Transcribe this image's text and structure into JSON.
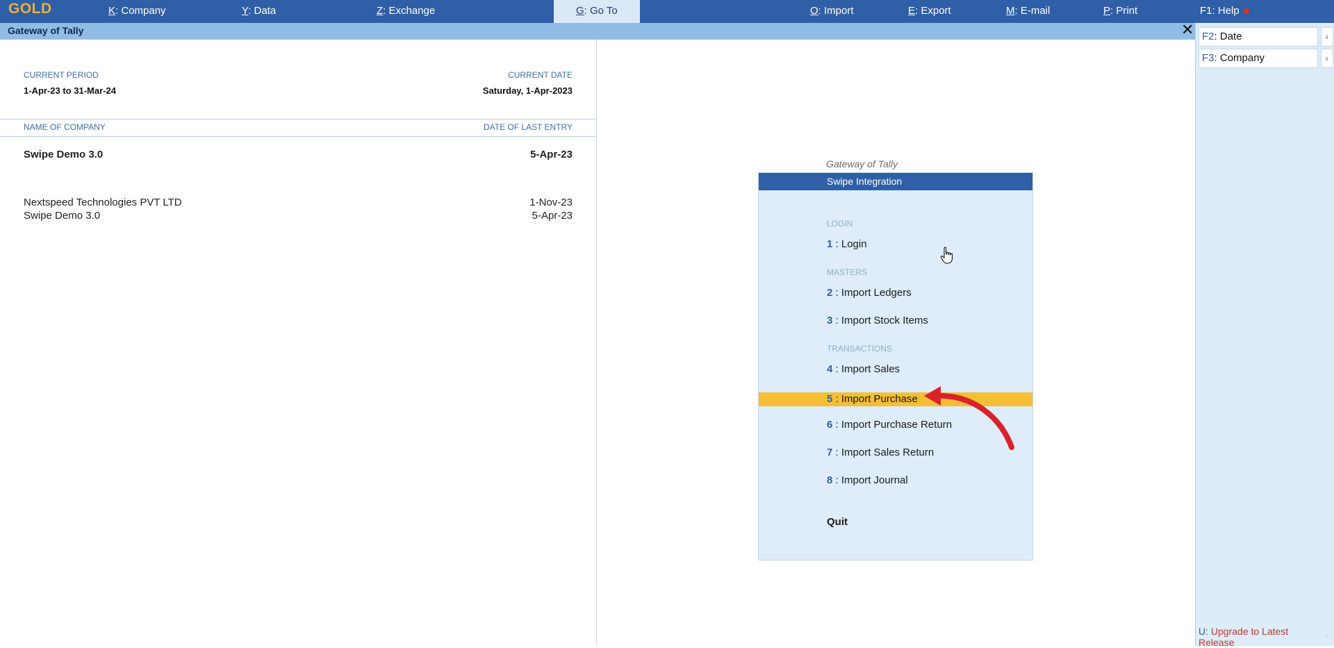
{
  "topbar": {
    "logo": "GOLD",
    "items": [
      {
        "key": "K",
        "label": "Company"
      },
      {
        "key": "Y",
        "label": "Data"
      },
      {
        "key": "Z",
        "label": "Exchange"
      },
      {
        "key": "G",
        "label": "Go To"
      },
      {
        "key": "O",
        "label": "Import"
      },
      {
        "key": "E",
        "label": "Export"
      },
      {
        "key": "M",
        "label": "E-mail"
      },
      {
        "key": "P",
        "label": "Print"
      },
      {
        "key": "F1",
        "label": "Help"
      }
    ]
  },
  "titlebar": {
    "title": "Gateway of Tally",
    "close": "✕"
  },
  "period": {
    "current_period_label": "CURRENT PERIOD",
    "current_period_value": "1-Apr-23 to 31-Mar-24",
    "current_date_label": "CURRENT DATE",
    "current_date_value": "Saturday, 1-Apr-2023"
  },
  "companies": {
    "name_header": "NAME OF COMPANY",
    "date_header": "DATE OF LAST ENTRY",
    "active": {
      "name": "Swipe Demo 3.0",
      "date": "5-Apr-23"
    },
    "list": [
      {
        "name": "Nextspeed Technologies PVT LTD",
        "date": "1-Nov-23"
      },
      {
        "name": "Swipe Demo 3.0",
        "date": "5-Apr-23"
      }
    ]
  },
  "menu": {
    "caption": "Gateway of Tally",
    "header": "Swipe Integration",
    "sections": {
      "login": "LOGIN",
      "masters": "MASTERS",
      "transactions": "TRANSACTIONS"
    },
    "items": [
      {
        "num": "1",
        "label": " : Login"
      },
      {
        "num": "2",
        "label": " : Import Ledgers"
      },
      {
        "num": "3",
        "label": " : Import Stock Items"
      },
      {
        "num": "4",
        "label": " : Import Sales"
      },
      {
        "num": "5",
        "label": " : Import Purchase"
      },
      {
        "num": "6",
        "label": " : Import Purchase Return"
      },
      {
        "num": "7",
        "label": " : Import Sales Return"
      },
      {
        "num": "8",
        "label": " : Import Journal"
      }
    ],
    "quit": "Quit",
    "selected_item": "5"
  },
  "sidebar": {
    "buttons": [
      {
        "key": "F2",
        "label": "Date"
      },
      {
        "key": "F3",
        "label": "Company"
      }
    ],
    "arrow": "‹",
    "upgrade_key": "U",
    "upgrade_label": "Upgrade to Latest Release"
  },
  "colors": {
    "topbar": "#2f5fa6",
    "logo": "#e7b23a",
    "title_strip": "#8fbde6",
    "menu_bg": "#deedf9",
    "selection": "#f3bf35",
    "annotation_arrow": "#d9222a"
  },
  "icons": {
    "cursor": "hand-pointer-icon",
    "close": "close-icon",
    "annotation": "red-curved-arrow-icon"
  }
}
